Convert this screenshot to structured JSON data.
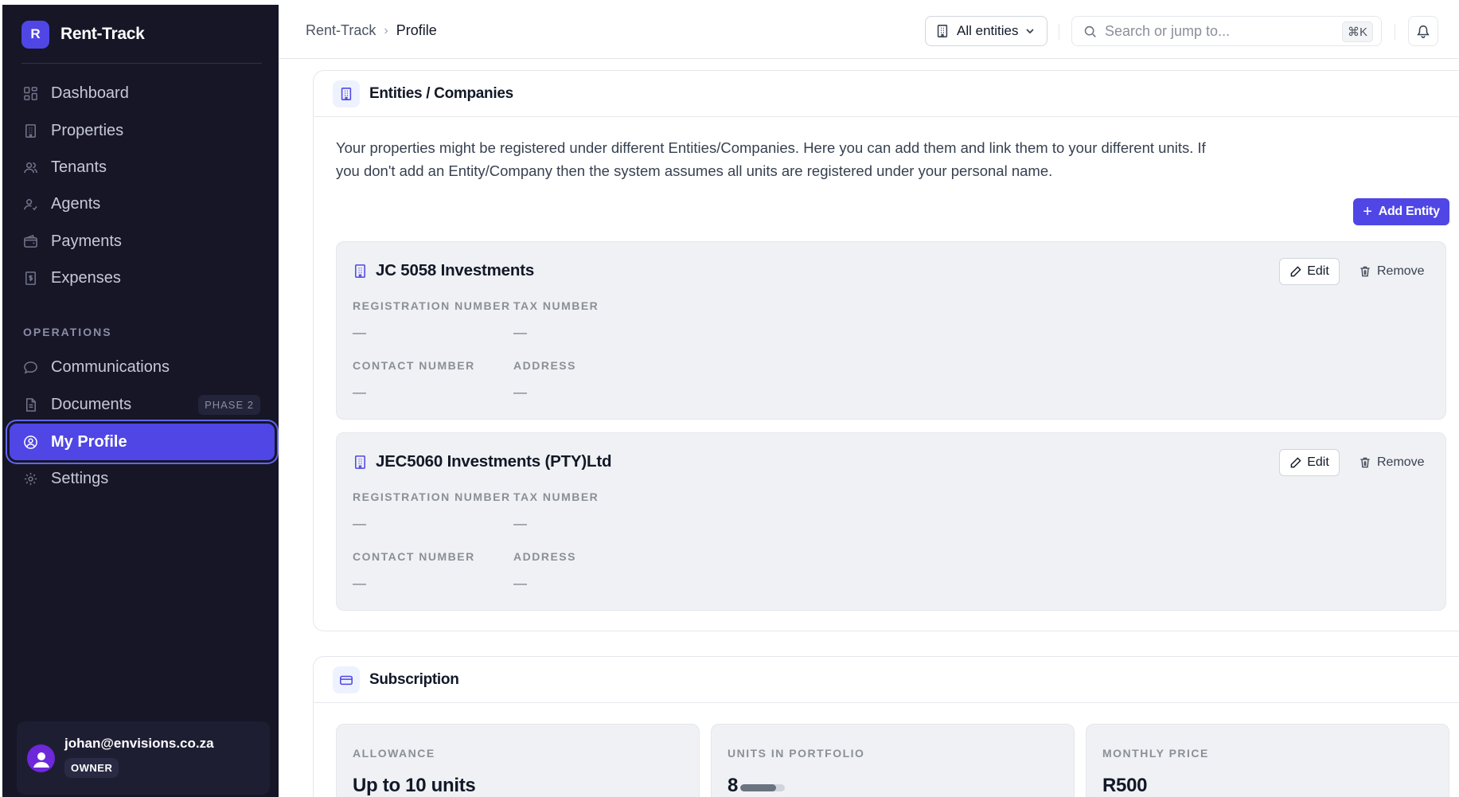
{
  "brand": {
    "logo_letter": "R",
    "name": "Rent-Track"
  },
  "sidebar": {
    "items": [
      {
        "label": "Dashboard",
        "icon": "dashboard-icon"
      },
      {
        "label": "Properties",
        "icon": "building-icon"
      },
      {
        "label": "Tenants",
        "icon": "users-icon"
      },
      {
        "label": "Agents",
        "icon": "user-check-icon"
      },
      {
        "label": "Payments",
        "icon": "wallet-icon"
      },
      {
        "label": "Expenses",
        "icon": "receipt-icon"
      }
    ],
    "section_label": "OPERATIONS",
    "ops_items": [
      {
        "label": "Communications",
        "icon": "chat-icon"
      },
      {
        "label": "Documents",
        "icon": "document-icon",
        "badge": "PHASE 2"
      },
      {
        "label": "My Profile",
        "icon": "user-circle-icon",
        "active": true
      },
      {
        "label": "Settings",
        "icon": "gear-icon"
      }
    ],
    "user": {
      "email": "johan@envisions.co.za",
      "role": "OWNER"
    }
  },
  "topbar": {
    "breadcrumb": [
      "Rent-Track",
      "Profile"
    ],
    "entity_filter": "All entities",
    "search_placeholder": "Search or jump to...",
    "search_shortcut": "⌘K"
  },
  "entities_section": {
    "title": "Entities / Companies",
    "description": "Your properties might be registered under different Entities/Companies. Here you can add them and link them to your different units. If you don't add an Entity/Company then the system assumes all units are registered under your personal name.",
    "add_button": "Add Entity",
    "edit_label": "Edit",
    "remove_label": "Remove",
    "field_labels": {
      "registration": "REGISTRATION NUMBER",
      "tax": "TAX NUMBER",
      "contact": "CONTACT NUMBER",
      "address": "ADDRESS"
    },
    "entities": [
      {
        "name": "JC 5058 Investments",
        "registration": "—",
        "tax": "—",
        "contact": "—",
        "address": "—"
      },
      {
        "name": "JEC5060 Investments (PTY)Ltd",
        "registration": "—",
        "tax": "—",
        "contact": "—",
        "address": "—"
      }
    ]
  },
  "subscription": {
    "title": "Subscription",
    "allowance_label": "ALLOWANCE",
    "allowance_value": "Up to 10 units",
    "units_label": "UNITS IN PORTFOLIO",
    "units_value": "8",
    "units_progress": 0.8,
    "price_label": "MONTHLY PRICE",
    "price_value": "R500"
  },
  "colors": {
    "accent": "#4f46e5",
    "sidebar_bg": "#161627"
  }
}
